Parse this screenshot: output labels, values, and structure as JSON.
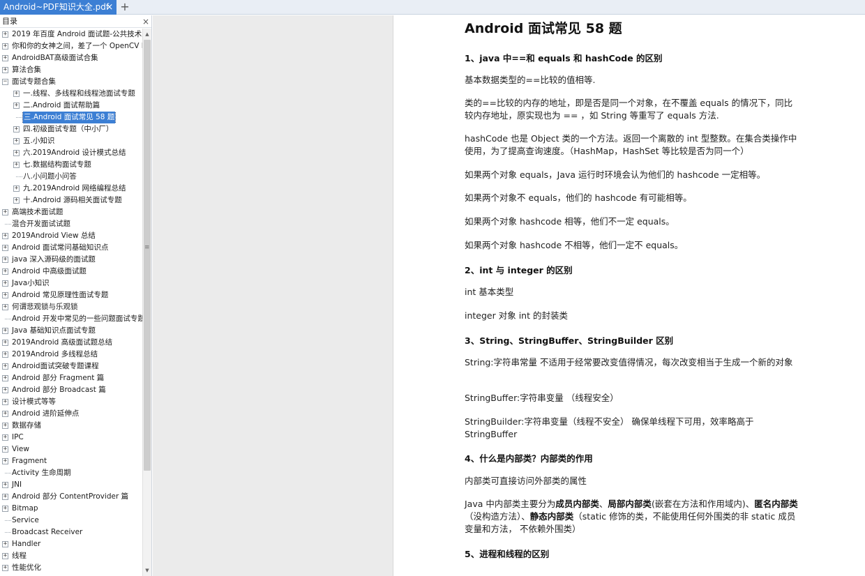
{
  "tabbar": {
    "tab_label": "Android~PDF知识大全.pdf",
    "close_glyph": "×",
    "add_glyph": "+"
  },
  "sidebar": {
    "title": "目录",
    "close_glyph": "×",
    "items": [
      {
        "label": "2019 年百度 Android 面试题-公共技术点",
        "level": 0,
        "expander": "+"
      },
      {
        "label": "你和你的女神之间，差了一个 OpenCV D",
        "level": 0,
        "expander": "+"
      },
      {
        "label": "AndroidBAT高级面试合集",
        "level": 0,
        "expander": "+"
      },
      {
        "label": "算法合集",
        "level": 0,
        "expander": "+"
      },
      {
        "label": "面试专题合集",
        "level": 0,
        "expander": "−"
      },
      {
        "label": "一.线程、多线程和线程池面试专题",
        "level": 1,
        "expander": "+"
      },
      {
        "label": "二.Android 面试帮助篇",
        "level": 1,
        "expander": "+"
      },
      {
        "label": "三.Android 面试常见 58 题",
        "level": 1,
        "expander": "",
        "selected": true
      },
      {
        "label": "四.初级面试专题（中小厂）",
        "level": 1,
        "expander": "+"
      },
      {
        "label": "五.小知识",
        "level": 1,
        "expander": "+"
      },
      {
        "label": "六.2019Android 设计模式总结",
        "level": 1,
        "expander": "+"
      },
      {
        "label": "七.数据结构面试专题",
        "level": 1,
        "expander": "+"
      },
      {
        "label": "八.小问题小问答",
        "level": 1,
        "expander": ""
      },
      {
        "label": "九.2019Android 网络编程总结",
        "level": 1,
        "expander": "+"
      },
      {
        "label": "十.Android 源码相关面试专题",
        "level": 1,
        "expander": "+"
      },
      {
        "label": "高端技术面试题",
        "level": 0,
        "expander": "+"
      },
      {
        "label": "混合开发面试试题",
        "level": 0,
        "expander": ""
      },
      {
        "label": "2019Android View 总结",
        "level": 0,
        "expander": "+"
      },
      {
        "label": "Android 面试常问基础知识点",
        "level": 0,
        "expander": "+"
      },
      {
        "label": "java 深入源码级的面试题",
        "level": 0,
        "expander": "+"
      },
      {
        "label": "Android 中高级面试题",
        "level": 0,
        "expander": "+"
      },
      {
        "label": "Java小知识",
        "level": 0,
        "expander": "+"
      },
      {
        "label": "Android 常见原理性面试专题",
        "level": 0,
        "expander": "+"
      },
      {
        "label": "何谓悲观锁与乐观锁",
        "level": 0,
        "expander": "+"
      },
      {
        "label": "Android 开发中常见的一些问题面试专题",
        "level": 0,
        "expander": ""
      },
      {
        "label": "Java 基础知识点面试专题",
        "level": 0,
        "expander": "+"
      },
      {
        "label": "2019Android 高级面试题总结",
        "level": 0,
        "expander": "+"
      },
      {
        "label": "2019Android 多线程总结",
        "level": 0,
        "expander": "+"
      },
      {
        "label": "Android面试突破专题课程",
        "level": 0,
        "expander": "+"
      },
      {
        "label": "Android 部分 Fragment 篇",
        "level": 0,
        "expander": "+"
      },
      {
        "label": "Android 部分 Broadcast 篇",
        "level": 0,
        "expander": "+"
      },
      {
        "label": "设计模式等等",
        "level": 0,
        "expander": "+"
      },
      {
        "label": "Android 进阶延伸点",
        "level": 0,
        "expander": "+"
      },
      {
        "label": "数据存储",
        "level": 0,
        "expander": "+"
      },
      {
        "label": "IPC",
        "level": 0,
        "expander": "+"
      },
      {
        "label": "View",
        "level": 0,
        "expander": "+"
      },
      {
        "label": "Fragment",
        "level": 0,
        "expander": "+"
      },
      {
        "label": "Activity 生命周期",
        "level": 0,
        "expander": ""
      },
      {
        "label": "JNI",
        "level": 0,
        "expander": "+"
      },
      {
        "label": "Android 部分 ContentProvider 篇",
        "level": 0,
        "expander": "+"
      },
      {
        "label": "Bitmap",
        "level": 0,
        "expander": "+"
      },
      {
        "label": "Service",
        "level": 0,
        "expander": ""
      },
      {
        "label": "Broadcast Receiver",
        "level": 0,
        "expander": ""
      },
      {
        "label": "Handler",
        "level": 0,
        "expander": "+"
      },
      {
        "label": "线程",
        "level": 0,
        "expander": "+"
      },
      {
        "label": "性能优化",
        "level": 0,
        "expander": "+"
      }
    ],
    "scroll_up_glyph": "▲",
    "scroll_down_glyph": "▼",
    "grip_glyph": "≡"
  },
  "document": {
    "title": "Android 面试常见 58 题",
    "q1": "1、java 中==和 equals 和 hashCode 的区别",
    "q1_p1": "基本数据类型的==比较的值相等.",
    "q1_p2": "类的==比较的内存的地址，即是否是同一个对象，在不覆盖 equals 的情况下，同比较内存地址，原实现也为 == ，如 String 等重写了 equals 方法.",
    "q1_p3": "hashCode 也是 Object 类的一个方法。返回一个离散的 int 型整数。在集合类操作中使用，为了提高查询速度。（HashMap，HashSet 等比较是否为同一个）",
    "q1_p4": "如果两个对象 equals，Java 运行时环境会认为他们的 hashcode 一定相等。",
    "q1_p5": "如果两个对象不 equals，他们的 hashcode 有可能相等。",
    "q1_p6": "如果两个对象 hashcode 相等，他们不一定 equals。",
    "q1_p7": "如果两个对象 hashcode 不相等，他们一定不 equals。",
    "q2": "2、int 与 integer 的区别",
    "q2_p1": "int  基本类型",
    "q2_p2": "integer  对象  int 的封装类",
    "q3": "3、String、StringBuffer、StringBuilder 区别",
    "q3_p1": "String:字符串常量  不适用于经常要改变值得情况，每次改变相当于生成一个新的对象",
    "q3_p2": "StringBuffer:字符串变量  （线程安全）",
    "q3_p3": "StringBuilder:字符串变量（线程不安全）  确保单线程下可用，效率略高于 StringBuffer",
    "q4": "4、什么是内部类？内部类的作用",
    "q4_p1": "内部类可直接访问外部类的属性",
    "q4_p2_a": "Java 中内部类主要分为",
    "q4_p2_b": "成员内部类",
    "q4_p2_c": "、",
    "q4_p2_d": "局部内部类",
    "q4_p2_e": "(嵌套在方法和作用域内)、",
    "q4_p2_f": "匿名内部类",
    "q4_p2_g": "（没构造方法）、",
    "q4_p2_h": "静态内部类",
    "q4_p2_i": "（static 修饰的类，不能使用任何外围类的非 static 成员变量和方法，  不依赖外围类）",
    "q5": "5、进程和线程的区别"
  }
}
